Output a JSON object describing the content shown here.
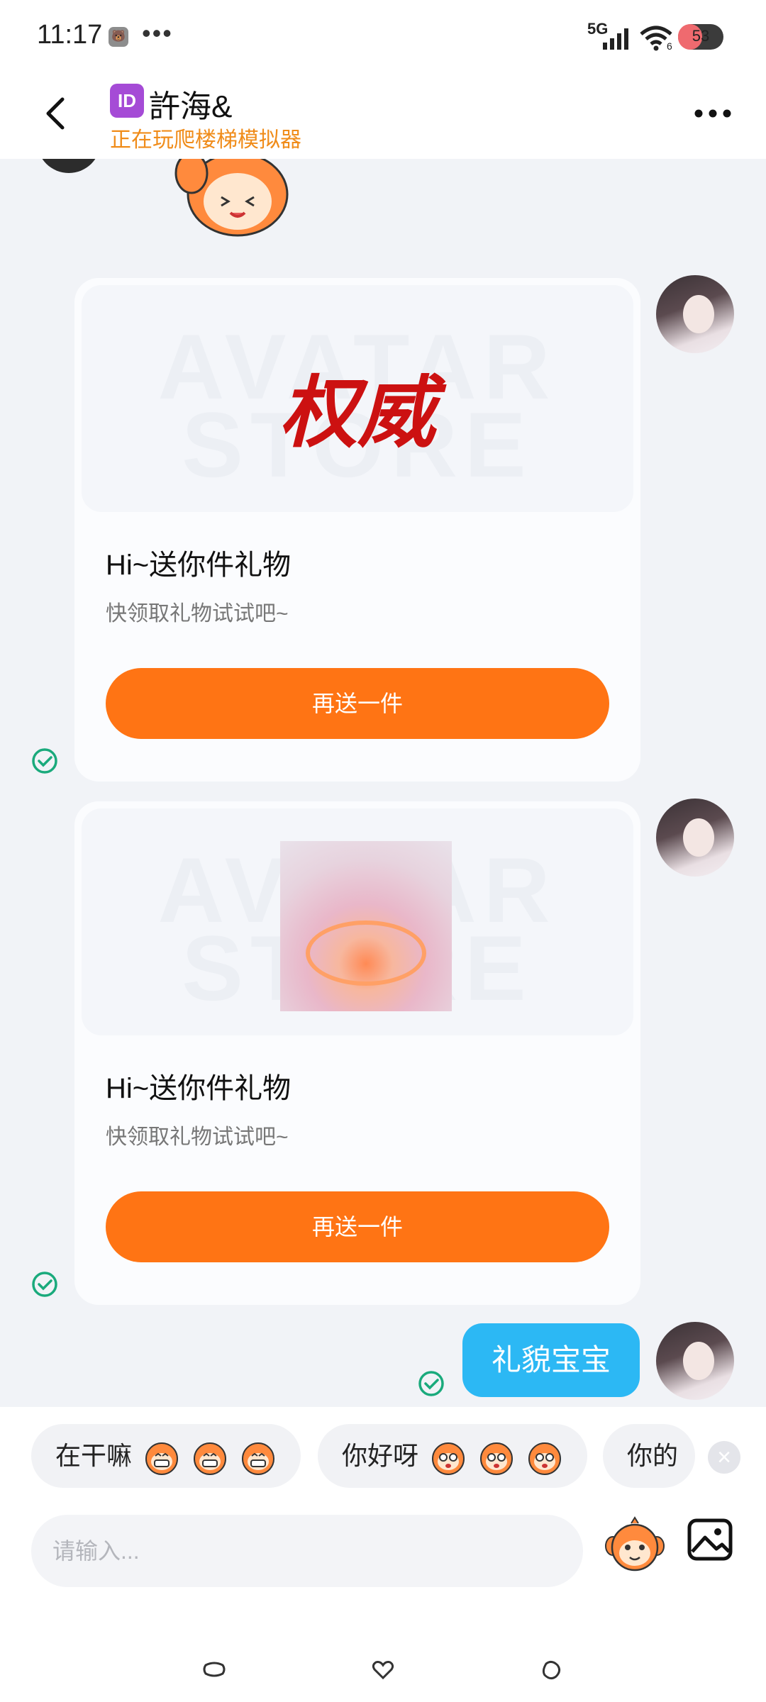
{
  "status_bar": {
    "time": "11:17",
    "app_icon": "🐻",
    "dots": "•••",
    "network": "5G",
    "wifi_sub": "6",
    "battery": "53",
    "battery_level": 0.53
  },
  "header": {
    "id_badge": "ID",
    "contact_name": "許海&",
    "status": "正在玩爬楼梯模拟器"
  },
  "messages": [
    {
      "type": "gift",
      "preview_text": "权威",
      "watermark_line1": "AVATAR",
      "watermark_line2": "STORE",
      "title": "Hi~送你件礼物",
      "subtitle": "快领取礼物试试吧~",
      "button": "再送一件",
      "status": "sent"
    },
    {
      "type": "gift",
      "watermark_line1": "AVATAR",
      "watermark_line2": "STORE",
      "title": "Hi~送你件礼物",
      "subtitle": "快领取礼物试试吧~",
      "button": "再送一件",
      "status": "sent"
    },
    {
      "type": "text",
      "text": "礼貌宝宝",
      "status": "sent"
    }
  ],
  "quick_replies": [
    {
      "text": "在干嘛",
      "emoji": "grinning-monkey-icon",
      "count": 3
    },
    {
      "text": "你好呀",
      "emoji": "surprised-monkey-icon",
      "count": 3
    },
    {
      "text": "你的"
    }
  ],
  "composer": {
    "placeholder": "请输入..."
  },
  "colors": {
    "accent_orange": "#ff7414",
    "status_orange": "#f08c1a",
    "bubble_blue": "#2cb8f4",
    "check_green": "#1aaa7c"
  }
}
